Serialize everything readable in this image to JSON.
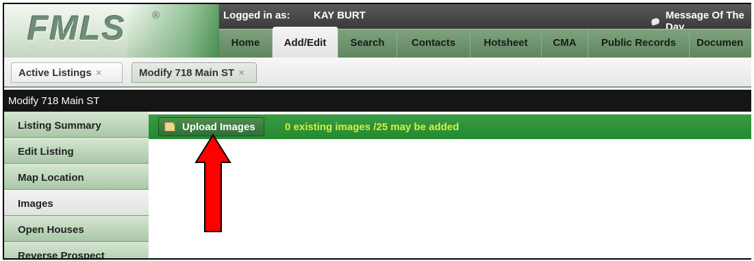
{
  "brand": {
    "logo_text": "FMLS",
    "logo_mark": "®"
  },
  "topbar": {
    "logged_in_label": "Logged in as:",
    "user_name": "KAY BURT",
    "message_of_day": "Message Of The Day",
    "message_icon": "speech-bubble-icon"
  },
  "nav": {
    "tabs": [
      {
        "label": "Home",
        "active": false
      },
      {
        "label": "Add/Edit",
        "active": true
      },
      {
        "label": "Search",
        "active": false
      },
      {
        "label": "Contacts",
        "active": false
      },
      {
        "label": "Hotsheet",
        "active": false
      },
      {
        "label": "CMA",
        "active": false
      },
      {
        "label": "Public Records",
        "active": false
      },
      {
        "label": "Documen",
        "active": false
      }
    ]
  },
  "doc_tabs": [
    {
      "label": "Active Listings",
      "close": "×",
      "active": false
    },
    {
      "label": "Modify 718 Main ST",
      "close": "×",
      "active": true
    }
  ],
  "page_title": "Modify 718 Main ST",
  "sidebar": {
    "items": [
      {
        "label": "Listing Summary",
        "active": false
      },
      {
        "label": "Edit Listing",
        "active": false
      },
      {
        "label": "Map Location",
        "active": false
      },
      {
        "label": "Images",
        "active": true
      },
      {
        "label": "Open Houses",
        "active": false
      },
      {
        "label": "Reverse Prospect",
        "active": false
      }
    ]
  },
  "images_panel": {
    "upload_button_label": "Upload Images",
    "upload_icon": "upload-image-icon",
    "status_text": "0 existing images /25 may be added"
  },
  "colors": {
    "upload_bar": "#238a30",
    "status_text": "#d4f03a",
    "annotation_arrow": "#ff0000"
  }
}
